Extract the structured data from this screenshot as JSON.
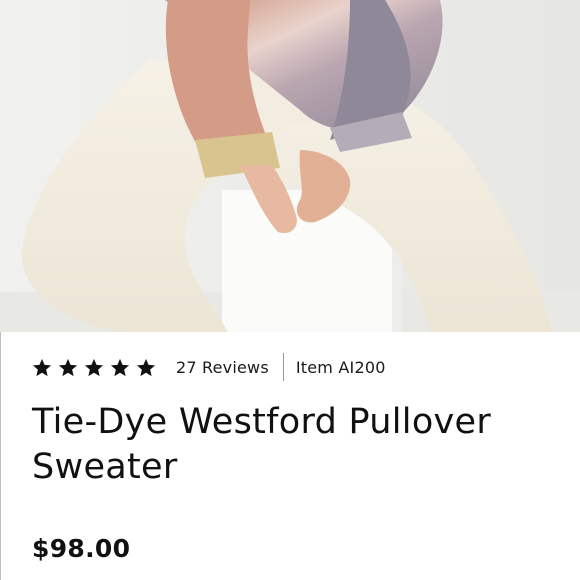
{
  "product": {
    "image_alt": "Model seated wearing a tie-dye sweater and cream pants",
    "rating": 5,
    "rating_max": 5,
    "reviews_label": "27 Reviews",
    "item_code": "Item AI200",
    "title": "Tie-Dye Westford Pullover Sweater",
    "price": "$98.00"
  },
  "colors": {
    "text": "#111111",
    "star": "#111111",
    "divider": "#9a9a9a"
  },
  "icons": {
    "star": "star-icon"
  }
}
